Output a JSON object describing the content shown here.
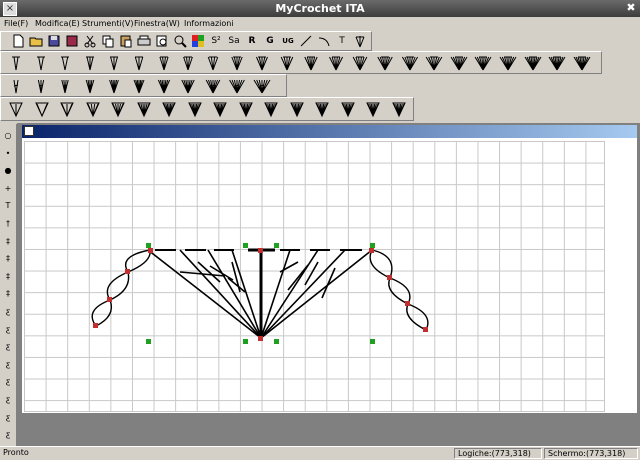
{
  "window": {
    "title": "MyCrochet ITA",
    "sys_icon": "window-menu-icon",
    "close_glyph": "✖"
  },
  "menu": [
    {
      "label": "File(F)"
    },
    {
      "label": "Modifica(E)"
    },
    {
      "label": "Strumenti(V)"
    },
    {
      "label": "Finestra(W)"
    },
    {
      "label": "Informazioni"
    }
  ],
  "toolbar": {
    "text_buttons": {
      "s": "S²",
      "sa": "Sa",
      "r": "R",
      "g": "G",
      "ug": "UG",
      "t": "T"
    }
  },
  "left_tools": [
    "○",
    "•",
    "●",
    "+",
    "T",
    "†",
    "‡",
    "‡",
    "‡",
    "‡",
    "ƹ",
    "ƹ",
    "ƹ",
    "ƹ",
    "ƹ",
    "ƹ",
    "ƹ",
    "ƹ"
  ],
  "status": {
    "ready": "Pronto",
    "logic": "Logiche:(773,318)",
    "screen": "Schermo:(773,318)"
  }
}
